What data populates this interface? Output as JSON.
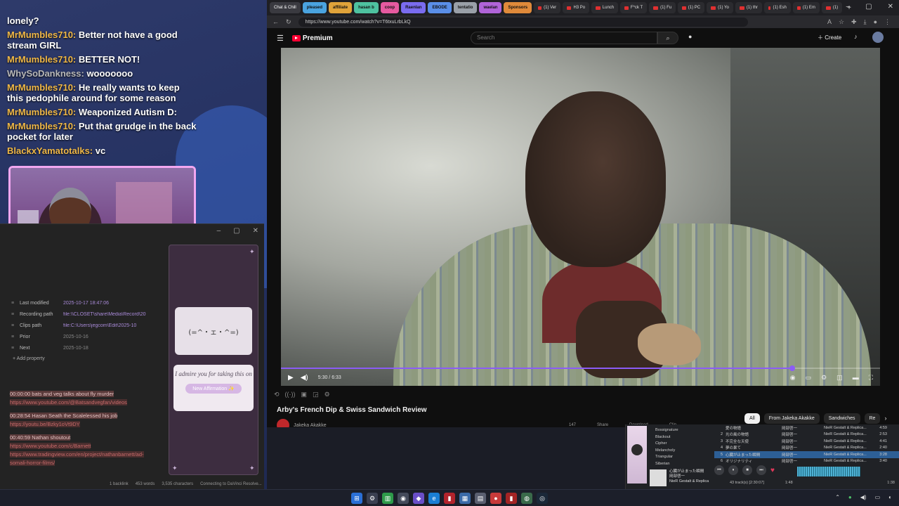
{
  "chat": {
    "messages": [
      {
        "user": "",
        "text": "lonely?"
      },
      {
        "user": "MrMumbles710:",
        "text": "Better not have a good stream GIRL"
      },
      {
        "user": "MrMumbles710:",
        "text": "BETTER NOT!"
      },
      {
        "user": "WhySoDankness:",
        "text": "wooooooo"
      },
      {
        "user": "MrMumbles710:",
        "text": "He really wants to keep this pedophile around for some reason"
      },
      {
        "user": "MrMumbles710:",
        "text": "Weaponized Autism D:"
      },
      {
        "user": "MrMumbles710:",
        "text": "Put that grudge in the back pocket for later"
      },
      {
        "user": "BlackxYamatotalks:",
        "text": "vc"
      }
    ]
  },
  "obsidian": {
    "properties": [
      {
        "key": "Last modified",
        "value": "2025-10-17 18:47:06"
      },
      {
        "key": "Recording path",
        "value": "file:\\\\CLOSET\\share\\Media\\Record\\20"
      },
      {
        "key": "Clips path",
        "value": "file:C:\\Users\\jegcom\\Edit\\2025-10"
      },
      {
        "key": "Prior",
        "value": "2025-10-16"
      },
      {
        "key": "Next",
        "value": "2025-10-18"
      }
    ],
    "add_property": "Add property",
    "notes": [
      {
        "ts": "00:00:00 bats and veg talks about fly murder",
        "link": "https://www.youtube.com/@Batsandvegfan/videos"
      },
      {
        "ts": "00:28:54 Hasan Seath the Scalelessed his job",
        "link": "https://youtu.be/Bzky1oVt9DY"
      },
      {
        "ts": "00:40:59 Nathan shoutout",
        "link": "https://www.youtube.com/c/Barnett https://www.tradingview.com/en/project/nathanbarnett/ad-somali-horror-films/"
      }
    ],
    "status": {
      "backlinks": "1 backlink",
      "words": "453 words",
      "chars": "3,535 characters",
      "sync": "Connecting to DaVinci Resolve..."
    }
  },
  "affirmation": {
    "face": "(=^・ェ・^=)",
    "text": "I admire you for taking this on",
    "button": "New Affirmation ✨"
  },
  "browser": {
    "tabs": [
      {
        "label": "Chat & Chill",
        "kind": "active"
      },
      {
        "label": "pleased",
        "kind": "grp",
        "color": "#4aa3df"
      },
      {
        "label": "affiliate",
        "kind": "grp",
        "color": "#e0a33a"
      },
      {
        "label": "hasan b",
        "kind": "grp",
        "color": "#4ec2a0"
      },
      {
        "label": "coop",
        "kind": "grp",
        "color": "#e65aa0"
      },
      {
        "label": "Raenlan",
        "kind": "grp",
        "color": "#7a6cf0"
      },
      {
        "label": "EBODE",
        "kind": "grp",
        "color": "#5a8fe8"
      },
      {
        "label": "tentatio",
        "kind": "grp",
        "color": "#9aa0a8"
      },
      {
        "label": "waelan",
        "kind": "grp",
        "color": "#b064d8"
      },
      {
        "label": "Sponsors",
        "kind": "grp",
        "color": "#e08a3a"
      },
      {
        "label": "(1) Ver",
        "kind": "yt"
      },
      {
        "label": "H3 Po",
        "kind": "yt"
      },
      {
        "label": "Lunch",
        "kind": "yt"
      },
      {
        "label": "F*ck T",
        "kind": "yt"
      },
      {
        "label": "(1) Fu",
        "kind": "yt"
      },
      {
        "label": "(1) PC",
        "kind": "yt"
      },
      {
        "label": "(1) Yo",
        "kind": "yt"
      },
      {
        "label": "(1) thr",
        "kind": "yt"
      },
      {
        "label": "(1) Esh",
        "kind": "yt"
      },
      {
        "label": "(1) Em",
        "kind": "yt"
      },
      {
        "label": "(1)",
        "kind": "yt"
      }
    ],
    "url": "https://www.youtube.com/watch?v=T6txuLrbLkQ"
  },
  "youtube": {
    "logo": "Premium",
    "search_placeholder": "Search",
    "create": "Create",
    "time": "5:30 / 6:33",
    "progress": 0.853,
    "title": "Arby's French Dip & Swiss Sandwich Review",
    "channel": "Jakeka Akakke",
    "actions": [
      "147",
      "Share",
      "Download",
      "Clip"
    ],
    "chips": [
      "All",
      "From Jakeka Akakke",
      "Sandwiches",
      "Re"
    ]
  },
  "music": {
    "genres": [
      "Bossignature",
      "Blackout",
      "Cipher",
      "Melancholy",
      "Triangular",
      "Siberian"
    ],
    "tracks": [
      {
        "n": "",
        "title": "愛の物語",
        "artist": "岡部啓一",
        "album": "NieR Gestalt & Replica...",
        "dur": "4:59"
      },
      {
        "n": "2",
        "title": "光の風の物語",
        "artist": "岡部啓一",
        "album": "NieR Gestalt & Replica...",
        "dur": "2:53"
      },
      {
        "n": "3",
        "title": "不完全な天使",
        "artist": "岡部啓一",
        "album": "NieR Gestalt & Replica...",
        "dur": "4:41"
      },
      {
        "n": "4",
        "title": "夢の果て",
        "artist": "岡部啓一",
        "album": "NieR Gestalt & Replica...",
        "dur": "2:40"
      },
      {
        "n": "5",
        "title": "心臓が止まった瞬間",
        "artist": "岡部啓一",
        "album": "NieR Gestalt & Replica...",
        "dur": "3:28"
      },
      {
        "n": "6",
        "title": "オリジナリティ",
        "artist": "岡部啓一",
        "album": "NieR Gestalt & Replica...",
        "dur": "3:40"
      }
    ],
    "selected_index": 4,
    "now_title": "心臓が止まった瞬間",
    "now_artist": "岡部啓一",
    "now_album": "NieR Gestalt & Replica",
    "footer": "43 track(s)  [2:30:07]",
    "elapsed": "1:48",
    "total": "1:38"
  }
}
